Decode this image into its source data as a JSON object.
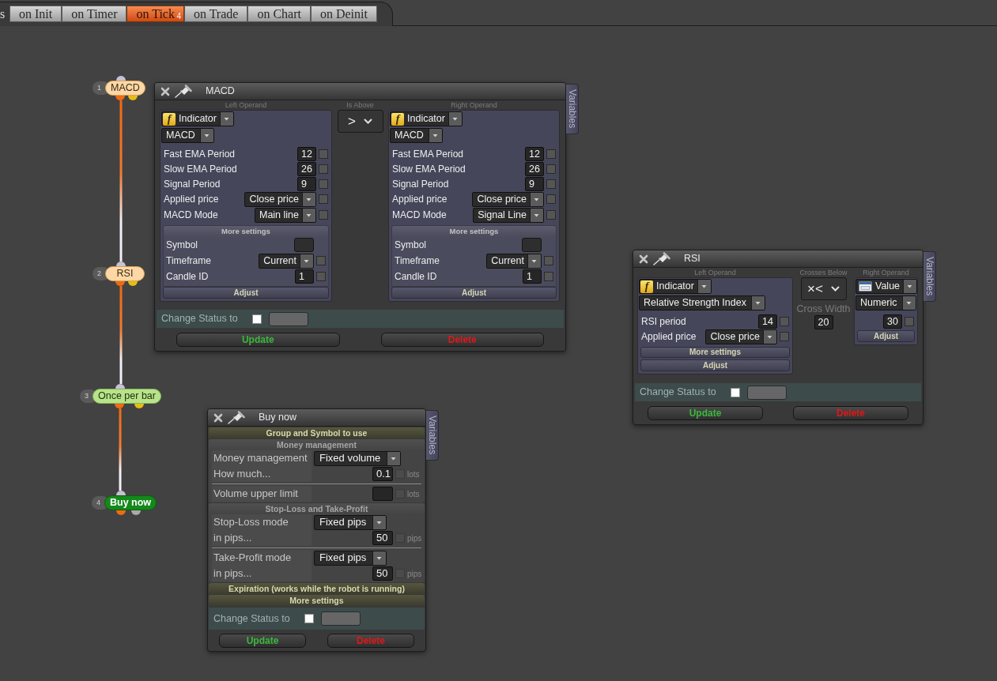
{
  "tab_bar": {
    "cut_label": "s",
    "tabs": [
      {
        "label": "on Init",
        "selected": false
      },
      {
        "label": "on Timer",
        "selected": false
      },
      {
        "label": "on Tick",
        "selected": true,
        "count": "4"
      },
      {
        "label": "on Trade",
        "selected": false
      },
      {
        "label": "on Chart",
        "selected": false
      },
      {
        "label": "on Deinit",
        "selected": false
      }
    ]
  },
  "nodes": [
    {
      "number": "1",
      "label": "MACD",
      "kind": "condition"
    },
    {
      "number": "2",
      "label": "RSI",
      "kind": "condition"
    },
    {
      "number": "3",
      "label": "Once per bar",
      "kind": "filter"
    },
    {
      "number": "4",
      "label": "Buy now",
      "kind": "action"
    }
  ],
  "windows": [
    {
      "kind": "condition",
      "title": "MACD",
      "side_tab": "Variables",
      "left_operand": {
        "heading": "Left Operand",
        "source": {
          "kind": "indicator",
          "icon": "f",
          "label": "Indicator"
        },
        "name": "MACD",
        "params": [
          {
            "label": "Fast EMA Period",
            "kind": "number",
            "value": "12",
            "checked": false
          },
          {
            "label": "Slow EMA Period",
            "kind": "number",
            "value": "26",
            "checked": false
          },
          {
            "label": "Signal Period",
            "kind": "number",
            "value": "9",
            "checked": false
          },
          {
            "label": "Applied price",
            "kind": "select",
            "value": "Close price",
            "checked": false
          },
          {
            "label": "MACD Mode",
            "kind": "select",
            "value": "Main line",
            "checked": false
          }
        ],
        "more_settings": {
          "label": "More settings",
          "expanded": true,
          "params": [
            {
              "label": "Symbol",
              "kind": "text"
            },
            {
              "label": "Timeframe",
              "kind": "select",
              "value": "Current",
              "checked": false
            },
            {
              "label": "Candle ID",
              "kind": "number",
              "value": "1",
              "checked": false
            }
          ]
        },
        "adjust": "Adjust"
      },
      "operator": {
        "heading": "Is Above",
        "symbol": ">"
      },
      "right_operand": {
        "heading": "Right Operand",
        "source": {
          "kind": "indicator",
          "icon": "f",
          "label": "Indicator"
        },
        "name": "MACD",
        "params": [
          {
            "label": "Fast EMA Period",
            "kind": "number",
            "value": "12",
            "checked": false
          },
          {
            "label": "Slow EMA Period",
            "kind": "number",
            "value": "26",
            "checked": false
          },
          {
            "label": "Signal Period",
            "kind": "number",
            "value": "9",
            "checked": false
          },
          {
            "label": "Applied price",
            "kind": "select",
            "value": "Close price",
            "checked": false
          },
          {
            "label": "MACD Mode",
            "kind": "select",
            "value": "Signal Line",
            "checked": false
          }
        ],
        "more_settings": {
          "label": "More settings",
          "expanded": true,
          "params": [
            {
              "label": "Symbol",
              "kind": "text"
            },
            {
              "label": "Timeframe",
              "kind": "select",
              "value": "Current",
              "checked": false
            },
            {
              "label": "Candle ID",
              "kind": "number",
              "value": "1",
              "checked": false
            }
          ]
        },
        "adjust": "Adjust"
      },
      "change_status": {
        "label": "Change Status to",
        "checked": false
      },
      "buttons": [
        {
          "label": "Update",
          "kind": "update"
        },
        {
          "label": "Delete",
          "kind": "delete"
        }
      ]
    },
    {
      "kind": "condition",
      "title": "RSI",
      "side_tab": "Variables",
      "left_operand": {
        "heading": "Left Operand",
        "source": {
          "kind": "indicator",
          "icon": "f",
          "label": "Indicator"
        },
        "name": "Relative Strength Index",
        "params": [
          {
            "label": "RSI period",
            "kind": "number",
            "value": "14",
            "checked": false
          },
          {
            "label": "Applied price",
            "kind": "select",
            "value": "Close price",
            "checked": false
          }
        ],
        "more_settings": {
          "label": "More settings",
          "expanded": false
        },
        "adjust": "Adjust"
      },
      "operator": {
        "heading": "Crosses Below",
        "symbol": "×<",
        "cross_width": {
          "label": "Cross Width",
          "value": "20"
        }
      },
      "right_operand": {
        "heading": "Right Operand",
        "source": {
          "kind": "value",
          "label": "Value"
        },
        "name": "Numeric",
        "params": [
          {
            "kind": "number",
            "value": "30",
            "checked": false
          }
        ],
        "adjust": "Adjust"
      },
      "change_status": {
        "label": "Change Status to",
        "checked": false
      },
      "buttons": [
        {
          "label": "Update",
          "kind": "update"
        },
        {
          "label": "Delete",
          "kind": "delete"
        }
      ]
    },
    {
      "kind": "action",
      "title": "Buy now",
      "side_tab": "Variables",
      "sections": [
        {
          "kind": "bar",
          "label": "Group and Symbol to use"
        },
        {
          "kind": "group",
          "label": "Money management",
          "blocks": [
            {
              "rows": [
                {
                  "label": "Money management",
                  "kind": "select",
                  "value": "Fixed volume"
                },
                {
                  "label": "How much...",
                  "kind": "number",
                  "value": "0.1",
                  "checked": false,
                  "unit": "lots"
                }
              ]
            },
            {
              "rows": [
                {
                  "label": "Volume upper limit",
                  "kind": "number",
                  "checked": false,
                  "unit": "lots"
                }
              ]
            }
          ]
        },
        {
          "kind": "group",
          "label": "Stop-Loss and Take-Profit",
          "blocks": [
            {
              "rows": [
                {
                  "label": "Stop-Loss mode",
                  "kind": "select",
                  "value": "Fixed pips"
                },
                {
                  "label": "in pips...",
                  "kind": "number",
                  "value": "50",
                  "checked": false,
                  "unit": "pips"
                }
              ]
            },
            {
              "rows": [
                {
                  "label": "Take-Profit mode",
                  "kind": "select",
                  "value": "Fixed pips"
                },
                {
                  "label": "in pips...",
                  "kind": "number",
                  "value": "50",
                  "checked": false,
                  "unit": "pips"
                }
              ]
            }
          ]
        },
        {
          "kind": "bar",
          "label": "Expiration (works while the robot is running)"
        },
        {
          "kind": "bar",
          "label": "More settings"
        }
      ],
      "change_status": {
        "label": "Change Status to",
        "checked": false
      },
      "buttons": [
        {
          "label": "Update",
          "kind": "update"
        },
        {
          "label": "Delete",
          "kind": "delete"
        }
      ]
    }
  ]
}
